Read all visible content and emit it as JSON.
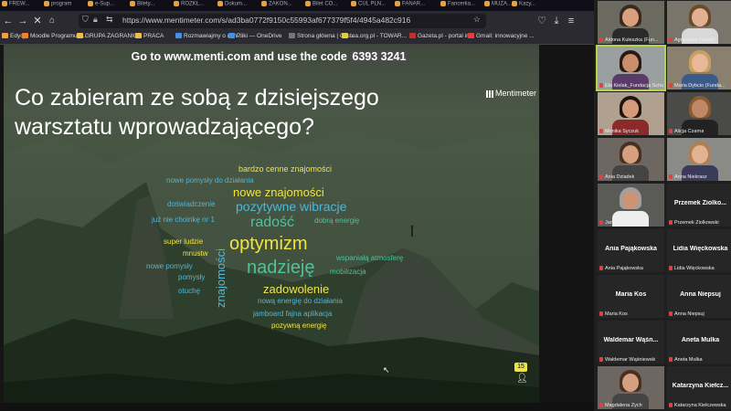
{
  "browser": {
    "tabs": [
      "FREW...",
      "program",
      "e-Sup...",
      "Bilety...",
      "ROZKŁ...",
      "Dokum...",
      "ZAKOŃ...",
      "Bilet CO...",
      "CUL PLN...",
      "FANAR...",
      "Fancerka...",
      "MUZA...",
      "Kazy..."
    ],
    "url": "https://www.mentimeter.com/s/ad3ba0772f9150c55993af677379f5f4/4945a482c916",
    "bookmarks": [
      {
        "label": "Edycja",
        "color": "#f0a040"
      },
      {
        "label": "Moodle Programu \"...",
        "color": "#f08030"
      },
      {
        "label": "GRUPA ZAGRANICA",
        "color": "#e8c04a"
      },
      {
        "label": "PRACA",
        "color": "#e8c04a"
      },
      {
        "label": "Rozmawiajmy o uch...",
        "color": "#4a90e2"
      },
      {
        "label": "Pliki — OneDrive",
        "color": "#4a90e2"
      },
      {
        "label": "Strona główna | Gru...",
        "color": "#777"
      },
      {
        "label": "tea.org.pl - TOWAR...",
        "color": "#e0d040"
      },
      {
        "label": "Gazeta.pl - portal in...",
        "color": "#c03030"
      },
      {
        "label": "Gmail: innowacyjne ...",
        "color": "#e04040"
      }
    ]
  },
  "slide": {
    "go_prefix": "Go to www.menti.com and use the code",
    "code": "6393 3241",
    "question": "Co zabieram ze sobą z dzisiejszego warsztatu wprowadzającego?",
    "brand": "Mentimeter",
    "count": "15",
    "words": [
      {
        "text": "bardzo cenne znajomości",
        "color": "#f0e442",
        "size": 9
      },
      {
        "text": "nowe pomysły do działania",
        "color": "#4fb7d8",
        "size": 8
      },
      {
        "text": "nowe znajomości",
        "color": "#f0e442",
        "size": 13
      },
      {
        "text": "doświadczenie",
        "color": "#4fb7d8",
        "size": 8
      },
      {
        "text": "pozytywne wibracje",
        "color": "#4fb7d8",
        "size": 14
      },
      {
        "text": "już nie choinkę nr 1",
        "color": "#4fb7d8",
        "size": 8
      },
      {
        "text": "radość",
        "color": "#4ec39a",
        "size": 16
      },
      {
        "text": "dobrą energię",
        "color": "#4ec39a",
        "size": 8
      },
      {
        "text": "super ludzie",
        "color": "#f0e442",
        "size": 8
      },
      {
        "text": "optymizm",
        "color": "#f0e442",
        "size": 20
      },
      {
        "text": "mnustw",
        "color": "#f0e442",
        "size": 8
      },
      {
        "text": "wspaniałą atmosferę",
        "color": "#4ec39a",
        "size": 8
      },
      {
        "text": "nowe pomysły",
        "color": "#4fb7d8",
        "size": 8
      },
      {
        "text": "nadzieję",
        "color": "#4ec39a",
        "size": 20
      },
      {
        "text": "mobilizacja",
        "color": "#4ec39a",
        "size": 8
      },
      {
        "text": "pomysły",
        "color": "#4fb7d8",
        "size": 8
      },
      {
        "text": "otuchę",
        "color": "#4fb7d8",
        "size": 8
      },
      {
        "text": "zadowolenie",
        "color": "#f0e442",
        "size": 13
      },
      {
        "text": "nową energię do działania",
        "color": "#4fb7d8",
        "size": 8
      },
      {
        "text": "jamboard fajna aplikacja",
        "color": "#4fb7d8",
        "size": 8
      },
      {
        "text": "pozywną energię",
        "color": "#f0e442",
        "size": 8
      }
    ],
    "vertical_word": {
      "text": "znajomości",
      "color": "#4fb7d8",
      "size": 13
    }
  },
  "participants": [
    {
      "name": "Aldona Kuleszka (Fun...",
      "video": true
    },
    {
      "name": "Agnieszka Jeromir",
      "video": true
    },
    {
      "name": "Ela Kielak_Fundacja Schu...",
      "video": true,
      "active": true
    },
    {
      "name": "Maria Dybcio (Funda...",
      "video": true
    },
    {
      "name": "Monika Syczuk",
      "video": true
    },
    {
      "name": "Alicja Czarna",
      "video": true
    },
    {
      "name": "Ania Dziadek",
      "video": true
    },
    {
      "name": "Anna  Niekrasz",
      "video": true
    },
    {
      "name": "Jan Stawicki",
      "video": true
    },
    {
      "name": "Przemek Ziolkowski",
      "display": "Przemek  Ziolko...",
      "video": false
    },
    {
      "name": "Ania Pająkowska",
      "display": "Ania Pająkowska",
      "video": false
    },
    {
      "name": "Lidia Więckowska",
      "display": "Lidia Więckowska",
      "video": false
    },
    {
      "name": "Maria Kos",
      "display": "Maria Kos",
      "video": false
    },
    {
      "name": "Anna Niepsuj",
      "display": "Anna Niepsuj",
      "video": false
    },
    {
      "name": "Waldemar Wąśniewski",
      "display": "Waldemar  Wąśn...",
      "video": false
    },
    {
      "name": "Aneta Mulka",
      "display": "Aneta Mulka",
      "video": false
    },
    {
      "name": "Magdalena Zych",
      "video": true
    },
    {
      "name": "Katarzyna Kiełczewska",
      "display": "Katarzyna  Kiełcz...",
      "video": false
    }
  ]
}
